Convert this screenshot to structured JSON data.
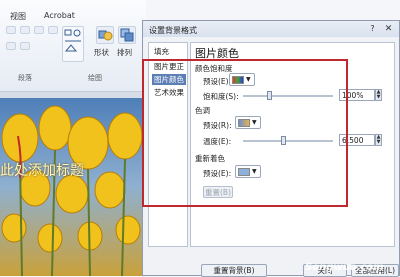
{
  "ribbon": {
    "tabs": [
      "视图",
      "Acrobat"
    ],
    "shape_label": "形状",
    "arrange_label": "排列",
    "group_label_left": "段落",
    "group_label_right": "绘图"
  },
  "slide": {
    "title_text": "此处添加标题"
  },
  "dialog": {
    "title": "设置背景格式",
    "help": "?",
    "close": "✕",
    "nav_items": [
      "填充",
      "图片更正",
      "图片颜色",
      "艺术效果"
    ],
    "selected_nav": "图片颜色",
    "panel_title": "图片颜色",
    "saturation": {
      "section": "颜色饱和度",
      "preset_label": "预设(E):",
      "saturation_label": "饱和度(S):",
      "value": "100%",
      "fraction": 0.3
    },
    "tone": {
      "section": "色调",
      "preset_label": "预设(R):",
      "temperature_label": "温度(E):",
      "value": "6,500",
      "fraction": 0.45
    },
    "recolor": {
      "section": "重新着色",
      "preset_label": "预设(E):",
      "reset_label": "重置(B)"
    },
    "buttons": {
      "reset_background": "重置背景(B)",
      "close": "关闭",
      "apply_all": "全部应用(L)"
    }
  },
  "watermark": "Songwuo.com",
  "colors": {
    "highlight_box": "#c0282f",
    "selected_nav_bg": "#5b7fb5"
  }
}
